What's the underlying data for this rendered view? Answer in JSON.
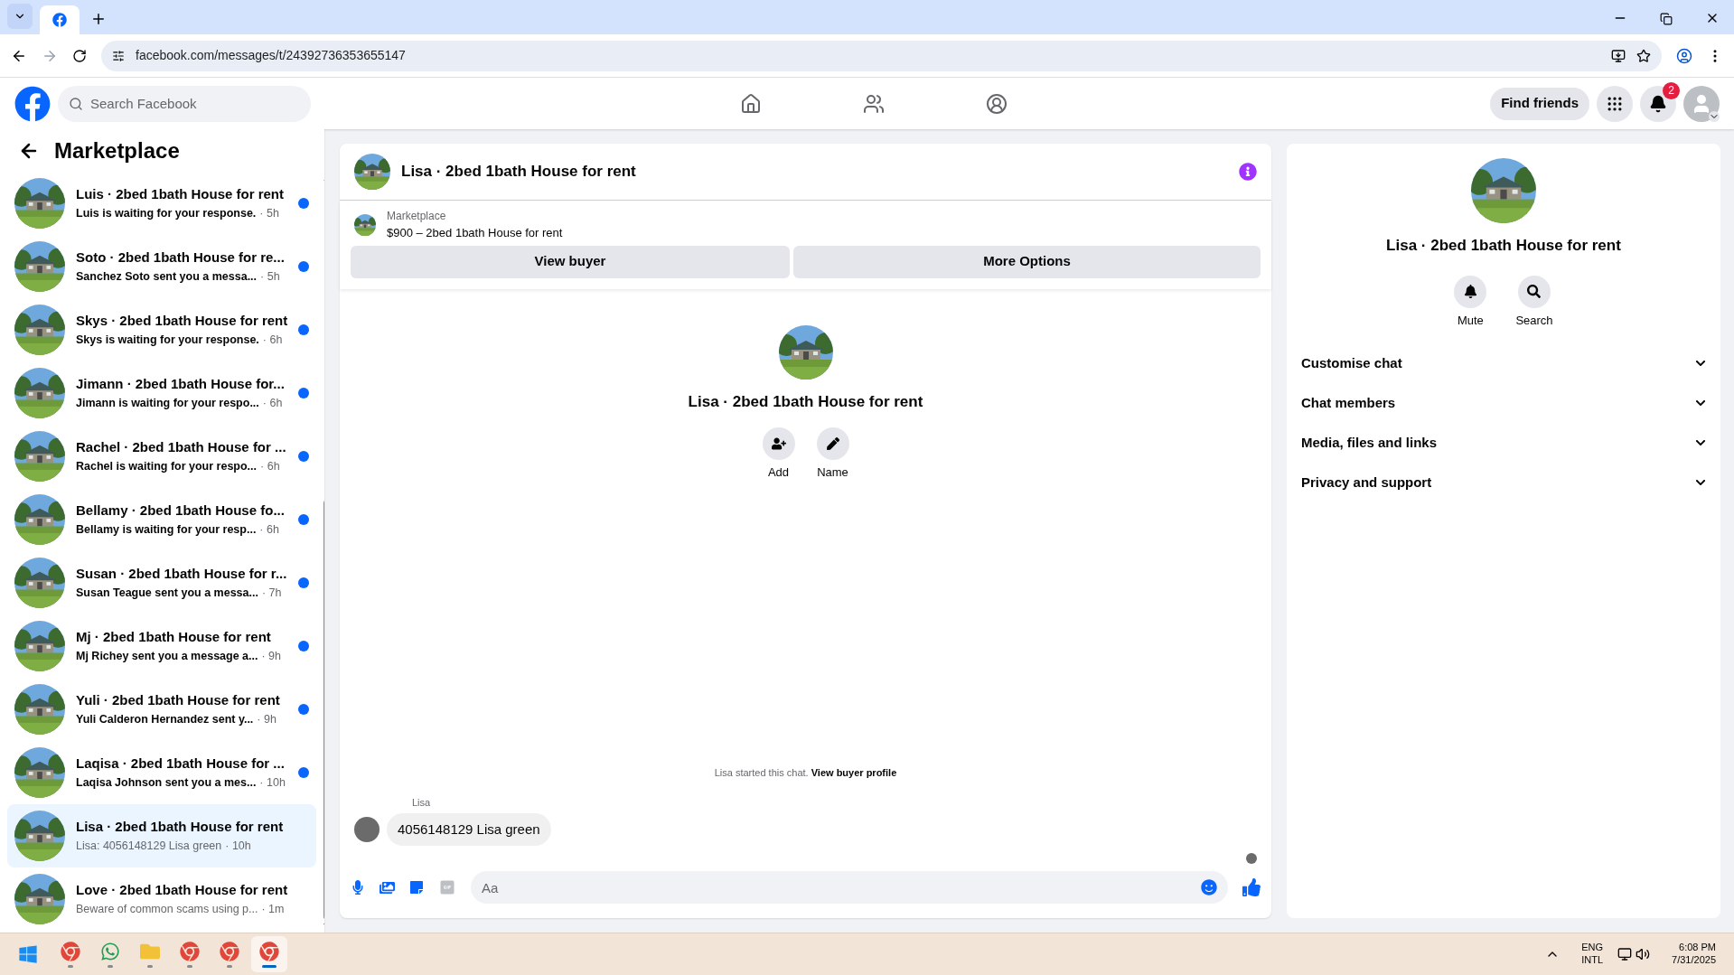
{
  "browser": {
    "url": "facebook.com/messages/t/24392736353655147"
  },
  "header": {
    "search": {
      "placeholder": "Search Facebook"
    },
    "find_friends": "Find friends",
    "notification_count": "2"
  },
  "sidebar": {
    "title": "Marketplace",
    "conversations": [
      {
        "title": "Luis · 2bed 1bath House for rent",
        "preview": "Luis is waiting for your response.",
        "time": "· 5h",
        "unread": true,
        "selected": false
      },
      {
        "title": "Soto · 2bed 1bath House for re...",
        "preview": "Sanchez Soto sent you a messa...",
        "time": "· 5h",
        "unread": true,
        "selected": false
      },
      {
        "title": "Skys · 2bed 1bath House for rent",
        "preview": "Skys is waiting for your response.",
        "time": "· 6h",
        "unread": true,
        "selected": false
      },
      {
        "title": "Jimann · 2bed 1bath House for...",
        "preview": "Jimann is waiting for your respo...",
        "time": "· 6h",
        "unread": true,
        "selected": false
      },
      {
        "title": "Rachel · 2bed 1bath House for ...",
        "preview": "Rachel is waiting for your respo...",
        "time": "· 6h",
        "unread": true,
        "selected": false
      },
      {
        "title": "Bellamy · 2bed 1bath House fo...",
        "preview": "Bellamy is waiting for your resp...",
        "time": "· 6h",
        "unread": true,
        "selected": false
      },
      {
        "title": "Susan · 2bed 1bath House for r...",
        "preview": "Susan Teague sent you a messa...",
        "time": "· 7h",
        "unread": true,
        "selected": false
      },
      {
        "title": "Mj · 2bed 1bath House for rent",
        "preview": "Mj Richey sent you a message a...",
        "time": "· 9h",
        "unread": true,
        "selected": false
      },
      {
        "title": "Yuli · 2bed 1bath House for rent",
        "preview": "Yuli Calderon Hernandez sent y...",
        "time": "· 9h",
        "unread": true,
        "selected": false
      },
      {
        "title": "Laqisa · 2bed 1bath House for ...",
        "preview": "Laqisa Johnson sent you a mes...",
        "time": "· 10h",
        "unread": true,
        "selected": false
      },
      {
        "title": "Lisa · 2bed 1bath House for rent",
        "preview": "Lisa: 4056148129 Lisa green",
        "time": "· 10h",
        "unread": false,
        "selected": true
      },
      {
        "title": "Love · 2bed 1bath House for rent",
        "preview": "Beware of common scams using p...",
        "time": "· 1m",
        "unread": false,
        "selected": false
      }
    ]
  },
  "chat": {
    "title": "Lisa · 2bed 1bath House for rent",
    "listing": {
      "label": "Marketplace",
      "price_title": "$900 – 2bed 1bath House for rent"
    },
    "buttons": [
      "View buyer",
      "More Options"
    ],
    "profile_name": "Lisa · 2bed 1bath House for rent",
    "actions": [
      "Add",
      "Name"
    ],
    "started": "Lisa started this chat.",
    "started_link": "View buyer profile",
    "messages": [
      {
        "sender": "Lisa",
        "text": "4056148129 Lisa green"
      }
    ],
    "composer": {
      "placeholder": "Aa"
    }
  },
  "details": {
    "name": "Lisa · 2bed 1bath House for rent",
    "actions": [
      "Mute",
      "Search"
    ],
    "sections": [
      {
        "label": "Customise chat",
        "expanded": false
      },
      {
        "label": "Chat members",
        "expanded": false
      },
      {
        "label": "Media, files and links",
        "expanded": false
      },
      {
        "label": "Privacy and support",
        "expanded": false
      }
    ]
  },
  "taskbar": {
    "apps": [
      {
        "kind": "chrome",
        "selected": false
      },
      {
        "kind": "whatsapp",
        "selected": false
      },
      {
        "kind": "folder",
        "selected": false
      },
      {
        "kind": "chrome",
        "selected": false
      },
      {
        "kind": "chrome",
        "selected": false
      },
      {
        "kind": "chrome",
        "selected": true
      }
    ],
    "language": "ENG",
    "layout": "INTL",
    "time": "6:08 PM",
    "date": "7/31/2025"
  }
}
